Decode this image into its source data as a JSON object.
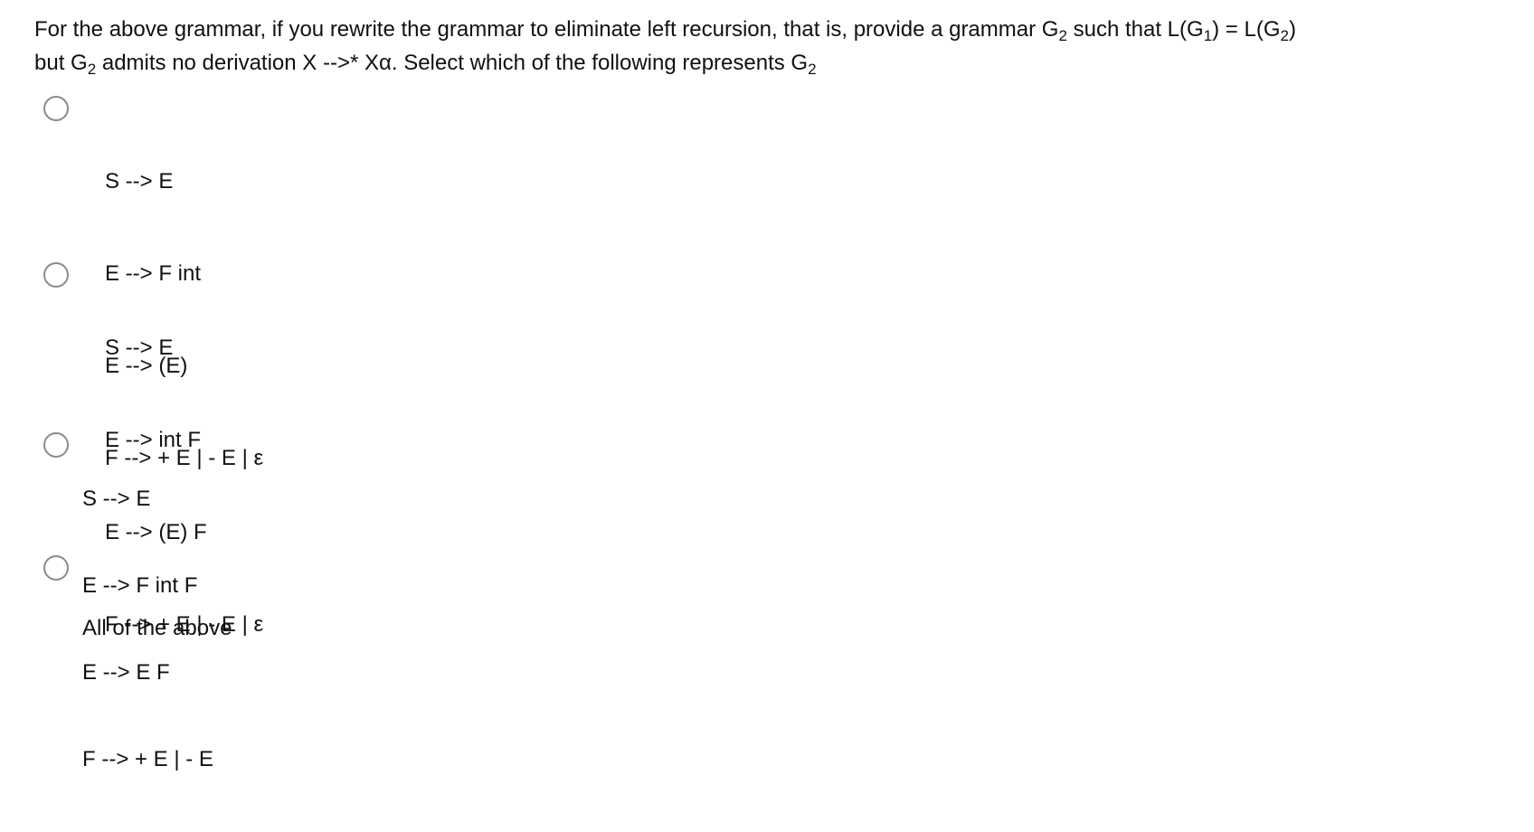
{
  "question": {
    "line1_a": "For the above grammar, if you rewrite the grammar to eliminate left recursion, that is, provide a grammar G",
    "line1_b": " such that L(G",
    "line1_c": ") = L(G",
    "line1_d": ")",
    "line2_a": "but G",
    "line2_b": " admits no derivation X -->* Xα. Select which of the following represents G",
    "sub2": "2",
    "sub1": "1"
  },
  "options": [
    {
      "lines": [
        "S --> E",
        "E --> F int",
        "E --> (E)",
        "F --> + E | - E | ε"
      ],
      "selected": false
    },
    {
      "lines": [
        "S --> E",
        "E --> int F",
        "E --> (E) F",
        "F --> + E | - E | ε"
      ],
      "selected": false
    },
    {
      "lines": [
        "S --> E",
        "E --> F int F",
        "E --> E F",
        "F --> + E | - E"
      ],
      "selected": false
    },
    {
      "lines": [
        "All of the above"
      ],
      "selected": false
    }
  ]
}
